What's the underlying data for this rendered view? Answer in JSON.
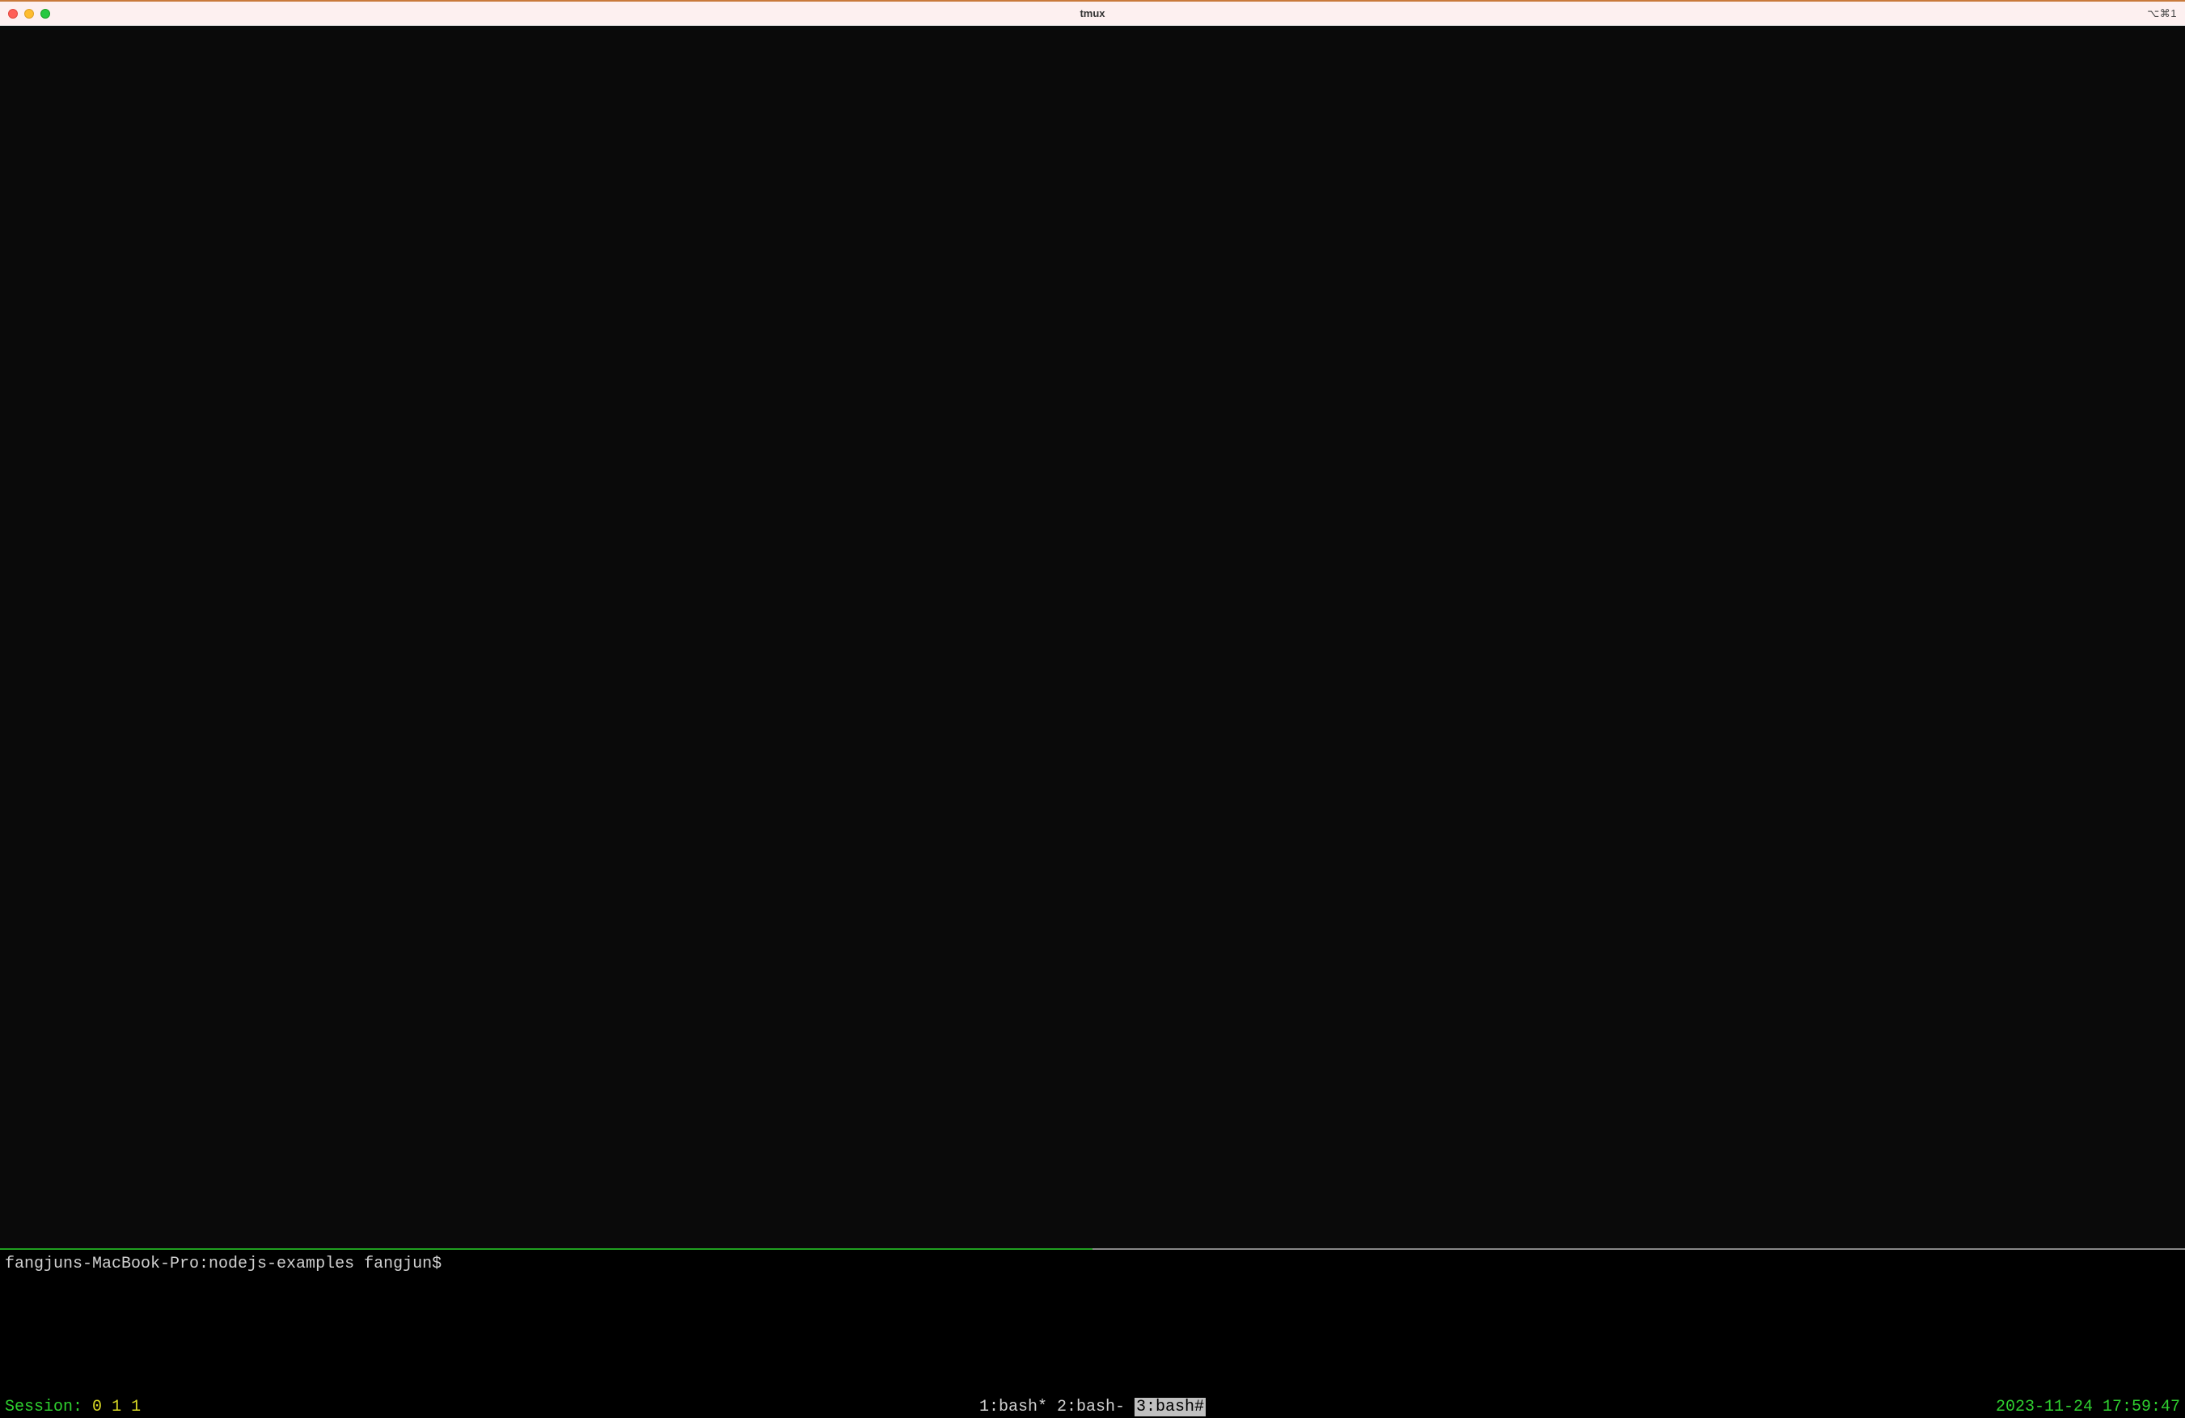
{
  "titlebar": {
    "title": "tmux",
    "right_indicator": "⌥⌘1"
  },
  "panes": {
    "bottom_prompt": "fangjuns-MacBook-Pro:nodejs-examples fangjun$"
  },
  "status": {
    "session_label": "Session:",
    "session_nums": [
      "0",
      "1",
      "1"
    ],
    "windows": [
      {
        "label": "1:bash*",
        "highlighted": false
      },
      {
        "label": "2:bash-",
        "highlighted": false
      },
      {
        "label": "3:bash#",
        "highlighted": true
      }
    ],
    "datetime": "2023-11-24 17:59:47"
  }
}
